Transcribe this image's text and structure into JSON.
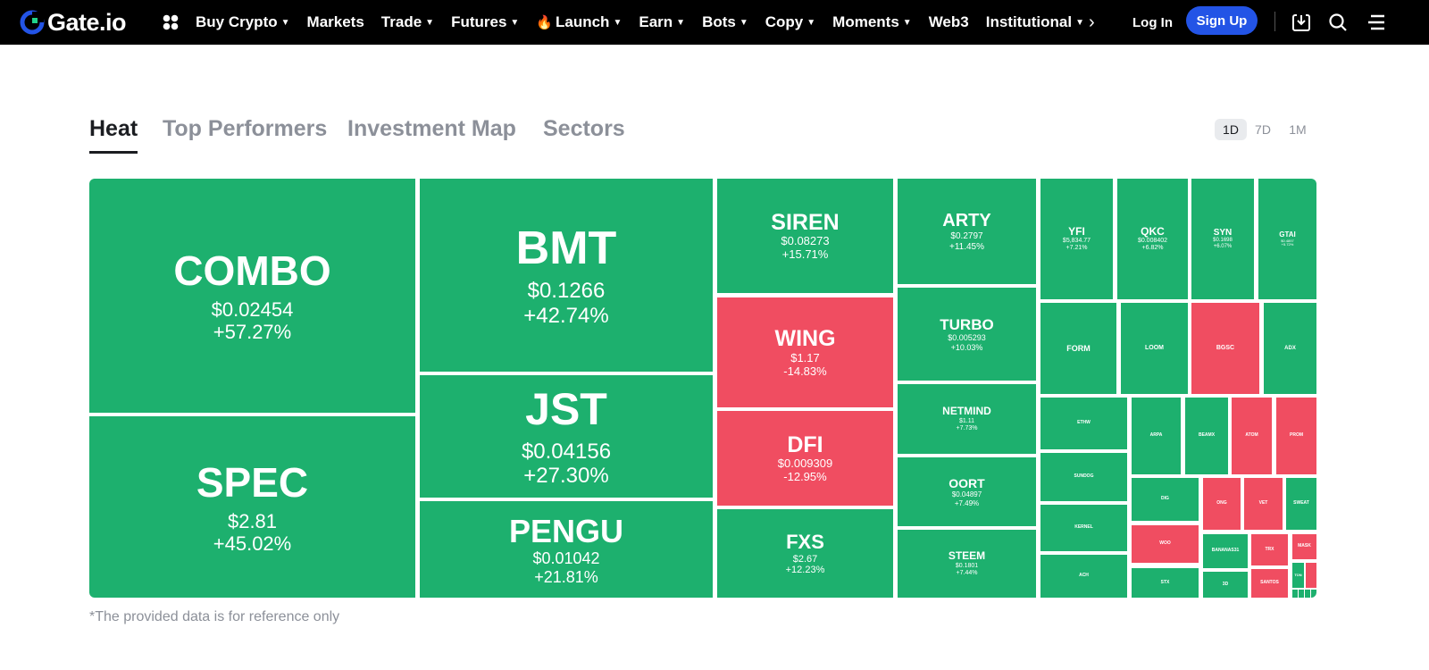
{
  "nav": {
    "logo_text": "Gate.io",
    "menu": [
      {
        "label": "Buy Crypto",
        "caret": true
      },
      {
        "label": "Markets",
        "caret": false
      },
      {
        "label": "Trade",
        "caret": true
      },
      {
        "label": "Futures",
        "caret": true
      },
      {
        "label": "Launch",
        "caret": true,
        "fire": true
      },
      {
        "label": "Earn",
        "caret": true
      },
      {
        "label": "Bots",
        "caret": true
      },
      {
        "label": "Copy",
        "caret": true
      },
      {
        "label": "Moments",
        "caret": true
      },
      {
        "label": "Web3",
        "caret": false
      },
      {
        "label": "Institutional",
        "caret": true
      }
    ],
    "login_label": "Log In",
    "signup_label": "Sign Up",
    "accent": "#2354e6"
  },
  "tabs": [
    {
      "label": "Heat",
      "active": true
    },
    {
      "label": "Top Performers",
      "active": false
    },
    {
      "label": "Investment Map",
      "active": false
    },
    {
      "label": "Sectors",
      "active": false
    }
  ],
  "periods": [
    {
      "label": "1D",
      "active": true
    },
    {
      "label": "7D",
      "active": false
    },
    {
      "label": "1M",
      "active": false
    }
  ],
  "colors": {
    "up": "#1db06e",
    "down": "#f04d61"
  },
  "heatmap": [
    {
      "symbol": "COMBO",
      "price": "$0.02454",
      "change": "+57.27%"
    },
    {
      "symbol": "SPEC",
      "price": "$2.81",
      "change": "+45.02%"
    },
    {
      "symbol": "BMT",
      "price": "$0.1266",
      "change": "+42.74%"
    },
    {
      "symbol": "JST",
      "price": "$0.04156",
      "change": "+27.30%"
    },
    {
      "symbol": "PENGU",
      "price": "$0.01042",
      "change": "+21.81%"
    },
    {
      "symbol": "SIREN",
      "price": "$0.08273",
      "change": "+15.71%"
    },
    {
      "symbol": "WING",
      "price": "$1.17",
      "change": "-14.83%"
    },
    {
      "symbol": "DFI",
      "price": "$0.009309",
      "change": "-12.95%"
    },
    {
      "symbol": "FXS",
      "price": "$2.67",
      "change": "+12.23%"
    },
    {
      "symbol": "ARTY",
      "price": "$0.2797",
      "change": "+11.45%"
    },
    {
      "symbol": "TURBO",
      "price": "$0.005293",
      "change": "+10.03%"
    },
    {
      "symbol": "NETMIND",
      "price": "$1.11",
      "change": "+7.73%"
    },
    {
      "symbol": "OORT",
      "price": "$0.04897",
      "change": "+7.49%"
    },
    {
      "symbol": "STEEM",
      "price": "$0.1801",
      "change": "+7.44%"
    },
    {
      "symbol": "YFI",
      "price": "$5,834.77",
      "change": "+7.21%"
    },
    {
      "symbol": "QKC",
      "price": "$0.008402",
      "change": "+6.82%"
    },
    {
      "symbol": "SYN",
      "price": "$0.1698",
      "change": "+6.07%"
    },
    {
      "symbol": "GTAI",
      "price": "$0.4897",
      "change": "+5.72%"
    },
    {
      "symbol": "FORM",
      "price": "",
      "change": ""
    },
    {
      "symbol": "LOOM",
      "price": "",
      "change": ""
    },
    {
      "symbol": "BGSC",
      "price": "",
      "change": ""
    },
    {
      "symbol": "ADX",
      "price": "",
      "change": ""
    },
    {
      "symbol": "ETHW",
      "price": "",
      "change": ""
    },
    {
      "symbol": "SUNDOG",
      "price": "",
      "change": ""
    },
    {
      "symbol": "KERNEL",
      "price": "",
      "change": ""
    },
    {
      "symbol": "ACH",
      "price": "",
      "change": ""
    },
    {
      "symbol": "ARPA",
      "price": "",
      "change": ""
    },
    {
      "symbol": "BEAMX",
      "price": "",
      "change": ""
    },
    {
      "symbol": "ATOM",
      "price": "",
      "change": ""
    },
    {
      "symbol": "PROM",
      "price": "",
      "change": ""
    },
    {
      "symbol": "DIG",
      "price": "",
      "change": ""
    },
    {
      "symbol": "ONG",
      "price": "",
      "change": ""
    },
    {
      "symbol": "VET",
      "price": "",
      "change": ""
    },
    {
      "symbol": "SWEAT",
      "price": "",
      "change": ""
    },
    {
      "symbol": "WOO",
      "price": "",
      "change": ""
    },
    {
      "symbol": "BANANAS31",
      "price": "",
      "change": ""
    },
    {
      "symbol": "TRX",
      "price": "",
      "change": ""
    },
    {
      "symbol": "MASK",
      "price": "",
      "change": ""
    },
    {
      "symbol": "STX",
      "price": "",
      "change": ""
    },
    {
      "symbol": "3D",
      "price": "",
      "change": ""
    },
    {
      "symbol": "SANTOS",
      "price": "",
      "change": ""
    },
    {
      "symbol": "TON",
      "price": "",
      "change": ""
    },
    {
      "symbol": "",
      "price": "",
      "change": ""
    },
    {
      "symbol": "",
      "price": "",
      "change": ""
    },
    {
      "symbol": "",
      "price": "",
      "change": ""
    },
    {
      "symbol": "",
      "price": "",
      "change": ""
    },
    {
      "symbol": "",
      "price": "",
      "change": ""
    }
  ],
  "disclaimer": "*The provided data is for reference only"
}
